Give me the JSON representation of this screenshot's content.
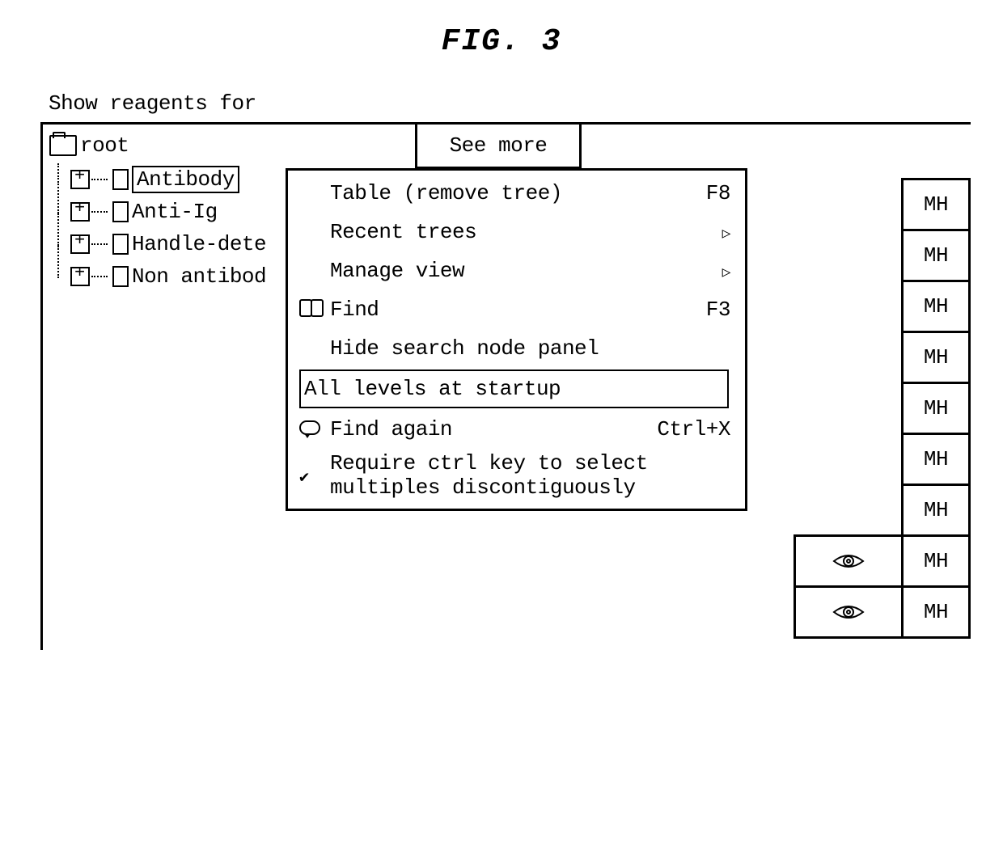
{
  "figure_label": "FIG. 3",
  "header": "Show reagents for",
  "tree": {
    "root_label": "root",
    "items": [
      {
        "label": "Antibody",
        "selected": true
      },
      {
        "label": "Anti-Ig",
        "selected": false
      },
      {
        "label": "Handle-dete",
        "selected": false
      },
      {
        "label": "Non antibod",
        "selected": false
      }
    ]
  },
  "see_more_label": "See more",
  "menu": {
    "items": [
      {
        "label": "Table (remove tree)",
        "shortcut": "F8",
        "icon": "",
        "submenu": false
      },
      {
        "label": "Recent trees",
        "shortcut": "",
        "icon": "",
        "submenu": true
      },
      {
        "label": "Manage view",
        "shortcut": "",
        "icon": "",
        "submenu": true
      },
      {
        "label": "Find",
        "shortcut": "F3",
        "icon": "binoculars",
        "submenu": false
      },
      {
        "label": "Hide search node panel",
        "shortcut": "",
        "icon": "",
        "submenu": false
      },
      {
        "label": "All levels at startup",
        "shortcut": "",
        "icon": "",
        "submenu": false,
        "highlighted": true
      },
      {
        "label": "Find again",
        "shortcut": "Ctrl+X",
        "icon": "bubble",
        "submenu": false
      },
      {
        "label": "Require ctrl key to select multiples discontiguously",
        "shortcut": "",
        "icon": "check",
        "submenu": false
      }
    ]
  },
  "right_tabs": [
    "MH",
    "MH",
    "MH",
    "MH",
    "MH",
    "MH",
    "MH",
    "MH",
    "MH"
  ]
}
